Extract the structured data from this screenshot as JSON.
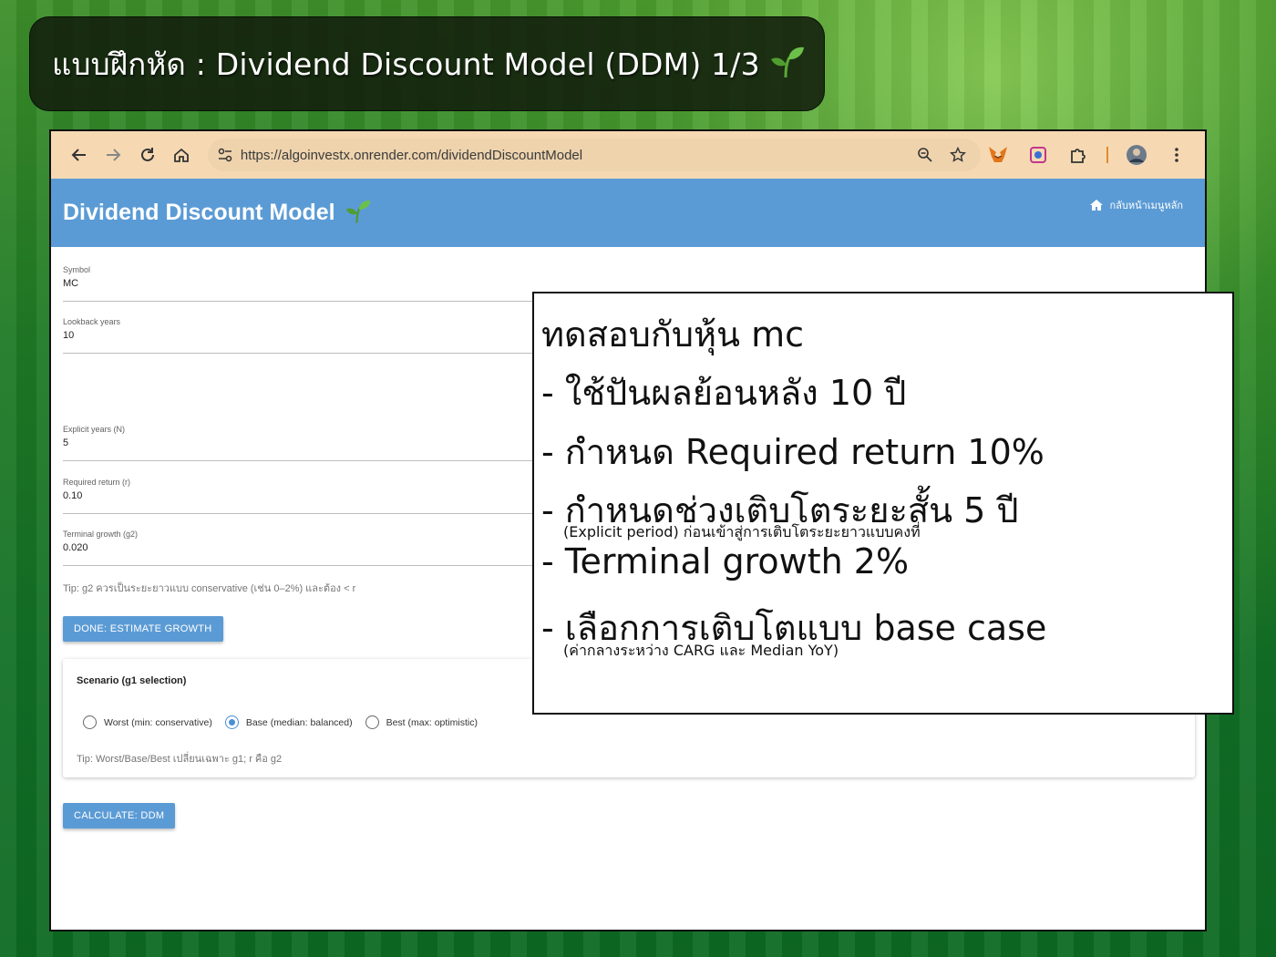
{
  "banner": {
    "title": "แบบฝึกหัด : Dividend Discount Model (DDM) 1/3"
  },
  "browser": {
    "url": "https://algoinvestx.onrender.com/dividendDiscountModel",
    "icons": [
      "back-icon",
      "forward-icon",
      "reload-icon",
      "home-icon",
      "site-settings-icon",
      "zoom-icon",
      "star-icon",
      "metamask-icon",
      "camera-extension-icon",
      "puzzle-icon",
      "profile-avatar",
      "kebab-menu-icon"
    ]
  },
  "appbar": {
    "title": "Dividend Discount Model",
    "home_link": "กลับหน้าเมนูหลัก"
  },
  "form": {
    "symbol": {
      "label": "Symbol",
      "value": "MC"
    },
    "lookback": {
      "label": "Lookback years",
      "value": "10"
    },
    "explicit": {
      "label": "Explicit years (N)",
      "value": "5"
    },
    "required_return": {
      "label": "Required return (r)",
      "value": "0.10"
    },
    "terminal_growth": {
      "label": "Terminal growth (g2)",
      "value": "0.020"
    },
    "tip": "Tip: g2 ควรเป็นระยะยาวแบบ conservative (เช่น 0–2%) และต้อง < r",
    "estimate_button": "DONE: ESTIMATE GROWTH",
    "calculate_button": "CALCULATE: DDM"
  },
  "scenario": {
    "title": "Scenario (g1 selection)",
    "options": [
      {
        "label": "Worst (min: conservative)",
        "selected": false
      },
      {
        "label": "Base (median: balanced)",
        "selected": true
      },
      {
        "label": "Best (max: optimistic)",
        "selected": false
      }
    ],
    "tip": "Tip: Worst/Base/Best เปลี่ยนเฉพาะ g1; r คือ g2"
  },
  "callout": {
    "line1": "ทดสอบกับหุ้น mc",
    "line2": "- ใช้ปันผลย้อนหลัง 10 ปี",
    "line3": "- กำหนด Required return 10%",
    "line4": "- กำหนดช่วงเติบโตระยะสั้น 5 ปี",
    "line4_sub": "(Explicit period) ก่อนเข้าสู่การเติบโตระยะยาวแบบคงที่",
    "line5": "- Terminal growth 2%",
    "line6": "- เลือกการเติบโตแบบ base case",
    "line6_sub": "(ค่ากลางระหว่าง CARG และ Median YoY)"
  }
}
